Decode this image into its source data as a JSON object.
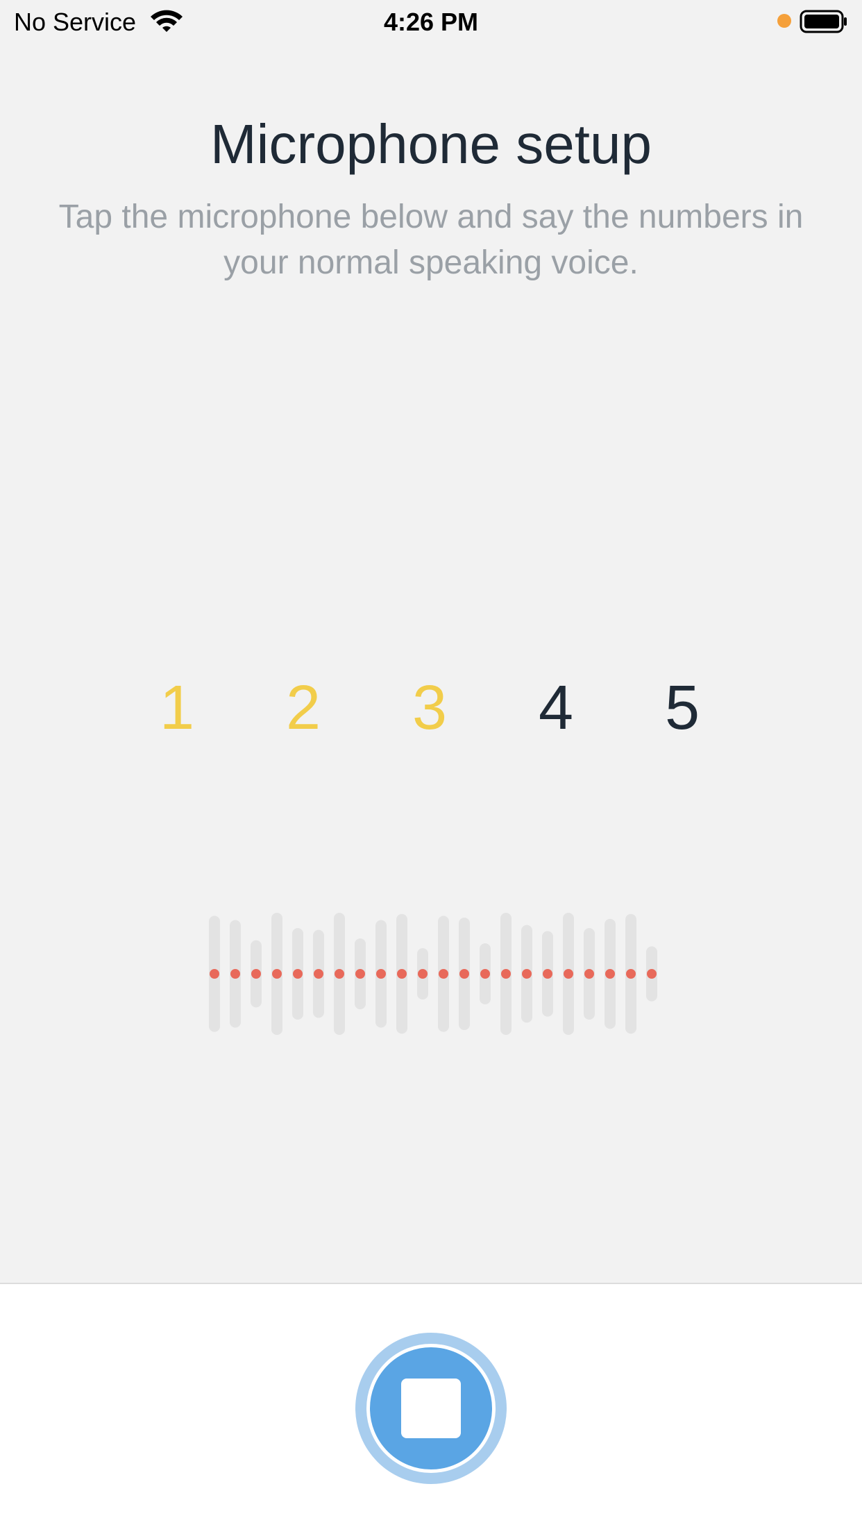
{
  "status_bar": {
    "carrier": "No Service",
    "time": "4:26 PM",
    "wifi_icon": "wifi-icon",
    "battery_icon": "battery-icon",
    "indicator_color": "#f5a03a"
  },
  "header": {
    "title": "Microphone setup",
    "subtitle": "Tap the microphone below and say the numbers in your normal speaking voice."
  },
  "digits": [
    {
      "label": "1",
      "spoken": true
    },
    {
      "label": "2",
      "spoken": true
    },
    {
      "label": "3",
      "spoken": true
    },
    {
      "label": "4",
      "spoken": false
    },
    {
      "label": "5",
      "spoken": false
    }
  ],
  "colors": {
    "spoken_digit": "#f2cd4a",
    "pending_digit": "#1f2a36",
    "waveform_bar": "#e3e3e3",
    "waveform_dot": "#e8695a",
    "button_fill": "#5aa5e4",
    "button_ring": "#a8cdee"
  },
  "waveform": {
    "icon": "audio-waveform-icon",
    "levels": [
      0.95,
      0.88,
      0.55,
      1.0,
      0.75,
      0.72,
      1.0,
      0.58,
      0.88,
      0.98,
      0.42,
      0.95,
      0.92,
      0.5,
      1.0,
      0.8,
      0.7,
      1.0,
      0.75,
      0.9,
      0.98,
      0.45
    ]
  },
  "record_button": {
    "icon": "stop-icon",
    "state": "recording"
  }
}
